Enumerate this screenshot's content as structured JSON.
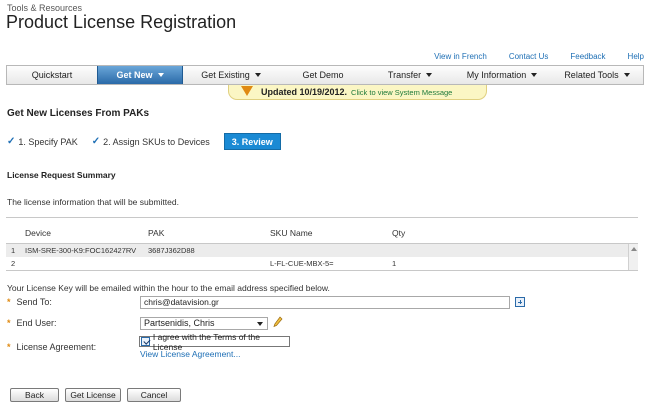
{
  "header": {
    "supertitle": "Tools & Resources",
    "title": "Product License Registration"
  },
  "top_links": [
    "View in French",
    "Contact Us",
    "Feedback",
    "Help"
  ],
  "nav": [
    {
      "label": "Quickstart",
      "active": false,
      "dropdown": false
    },
    {
      "label": "Get New",
      "active": true,
      "dropdown": true
    },
    {
      "label": "Get Existing",
      "active": false,
      "dropdown": true
    },
    {
      "label": "Get Demo",
      "active": false,
      "dropdown": false
    },
    {
      "label": "Transfer",
      "active": false,
      "dropdown": true
    },
    {
      "label": "My Information",
      "active": false,
      "dropdown": true
    },
    {
      "label": "Related Tools",
      "active": false,
      "dropdown": true
    }
  ],
  "system_message": {
    "updated": "Updated 10/19/2012.",
    "link": "Click to view System Message"
  },
  "section_title": "Get New Licenses From PAKs",
  "steps": [
    {
      "label": "1. Specify PAK",
      "done": true
    },
    {
      "label": "2. Assign SKUs to Devices",
      "done": true
    },
    {
      "label": "3. Review",
      "current": true
    }
  ],
  "summary": {
    "title": "License Request Summary",
    "description": "The license information that will be submitted."
  },
  "table": {
    "headers": [
      "Device",
      "PAK",
      "SKU Name",
      "Qty"
    ],
    "rows": [
      {
        "index": "1",
        "device": "ISM-SRE-300-K9:FOC162427RV",
        "pak": "3687J362D88",
        "sku": "",
        "qty": ""
      },
      {
        "index": "2",
        "device": "",
        "pak": "",
        "sku": "L-FL-CUE-MBX-5=",
        "qty": "1"
      }
    ]
  },
  "email_note": "Your License Key will be emailed within the hour to the email address specified below.",
  "form": {
    "required_marker": "*",
    "send_to_label": "Send To:",
    "send_to_value": "chris@datavision.gr",
    "end_user_label": "End User:",
    "end_user_value": "Partsenidis, Chris",
    "agreement_label": "License Agreement:",
    "agreement_text": "I agree with the Terms of the License",
    "view_agreement": "View License Agreement..."
  },
  "buttons": {
    "back": "Back",
    "get_license": "Get License",
    "cancel": "Cancel"
  },
  "colors": {
    "link": "#1e6fb5",
    "nav_active": "#2a6aa8",
    "step_current": "#1a8ad4",
    "required": "#e08a12",
    "message_bg": "#fbf6c4"
  }
}
